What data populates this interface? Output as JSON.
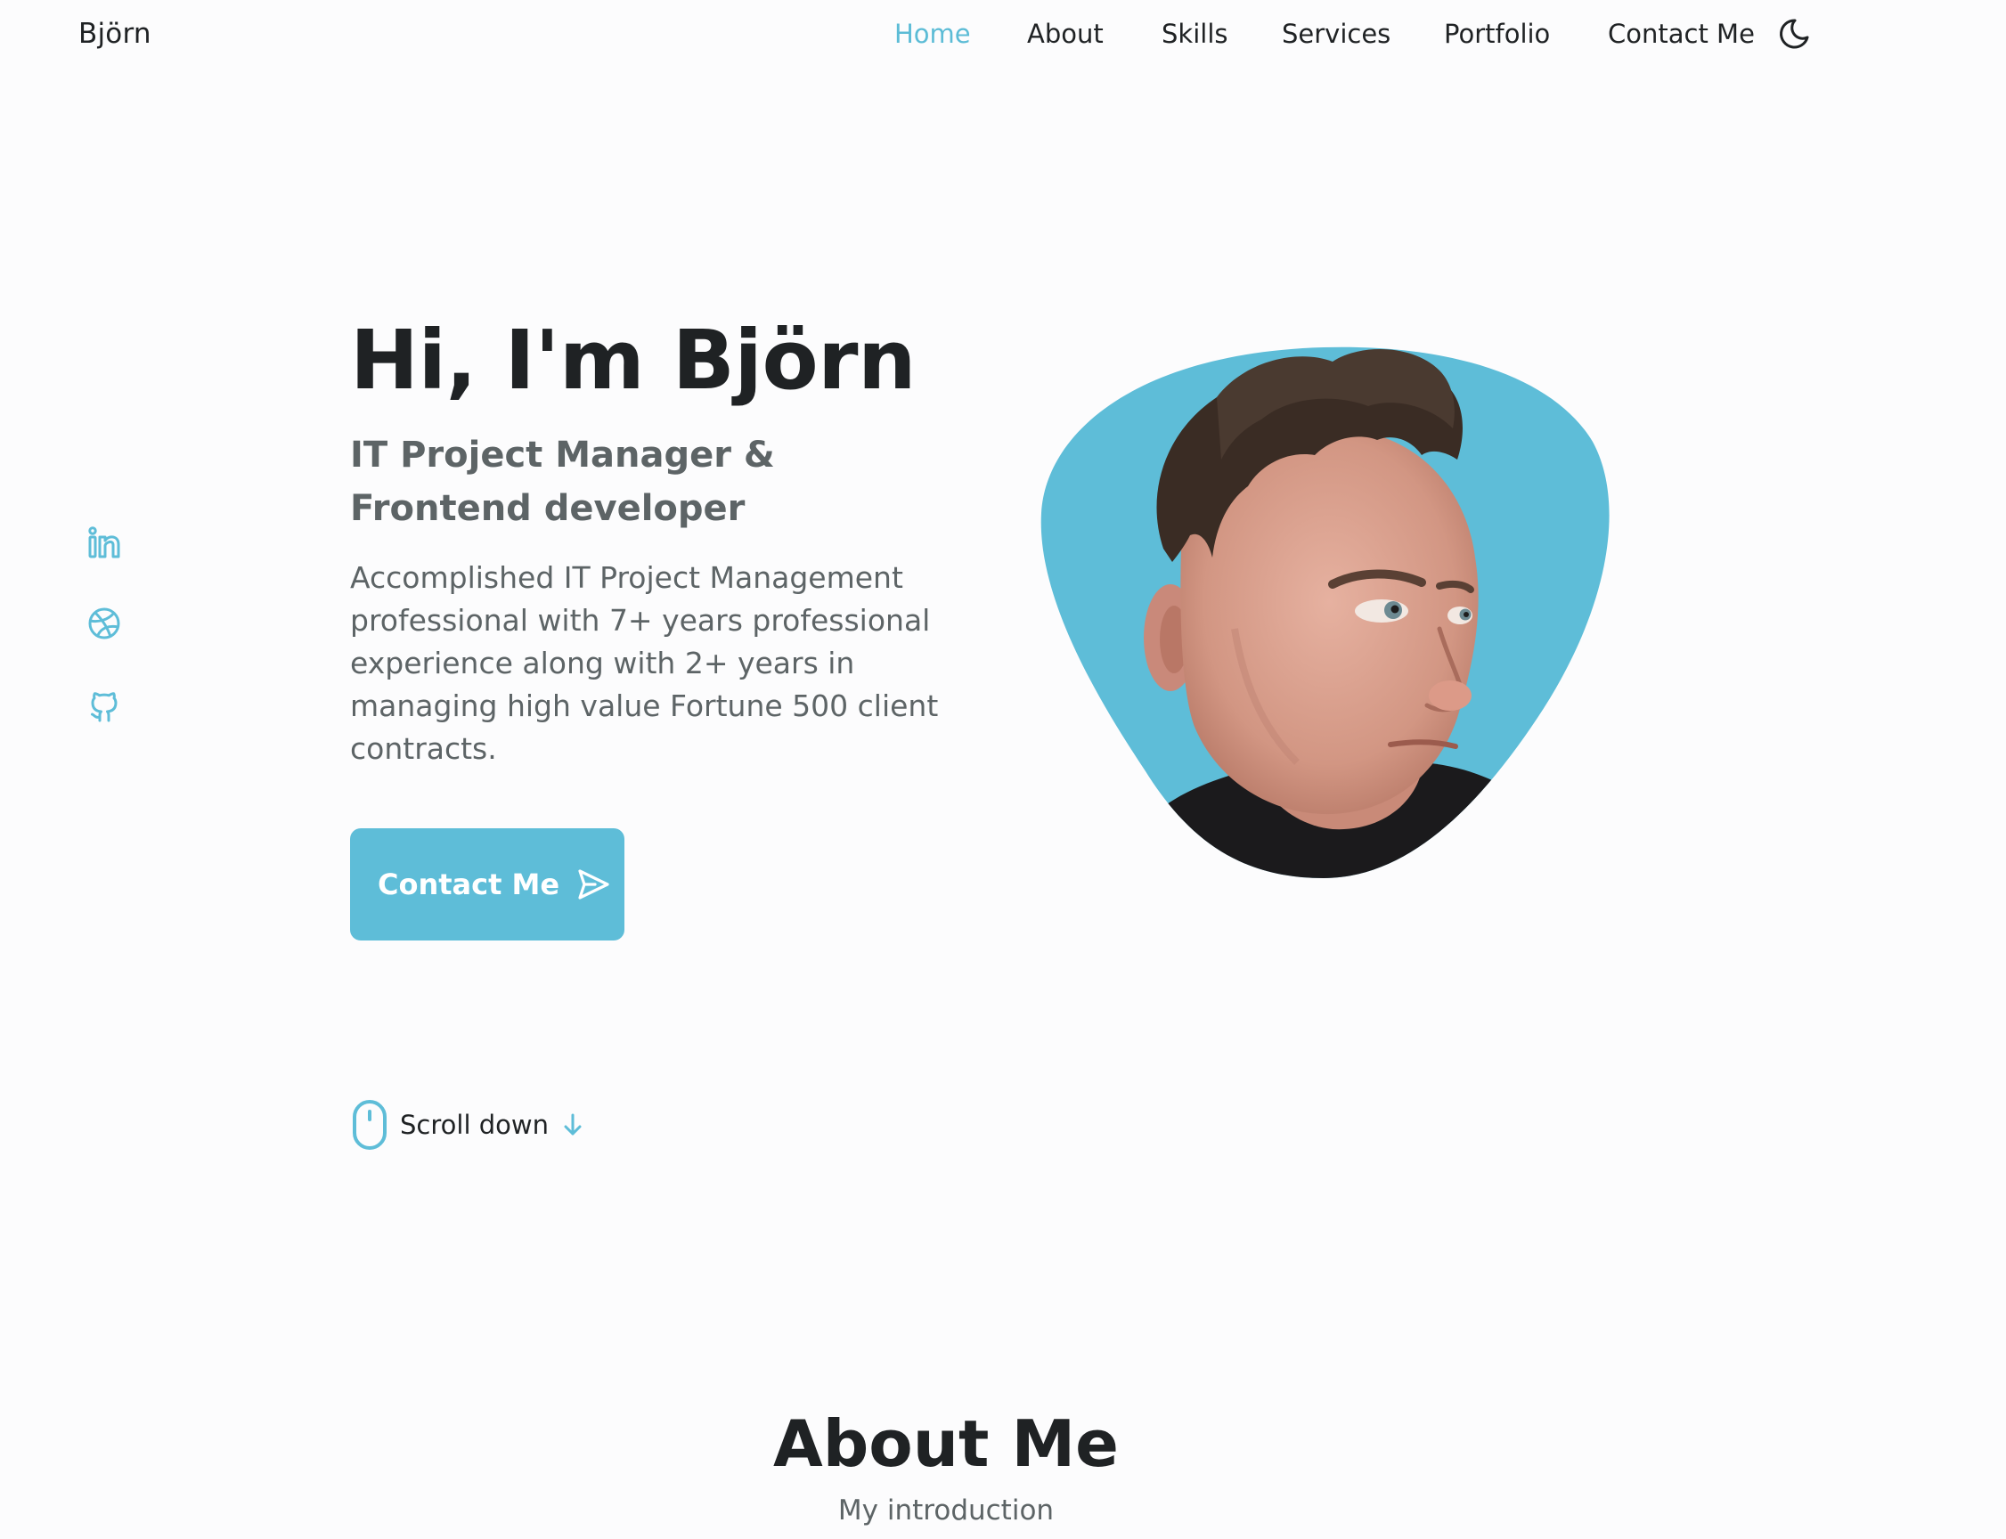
{
  "brand": {
    "name": "Björn"
  },
  "nav": {
    "items": [
      {
        "label": "Home",
        "active": true
      },
      {
        "label": "About",
        "active": false
      },
      {
        "label": "Skills",
        "active": false
      },
      {
        "label": "Services",
        "active": false
      },
      {
        "label": "Portfolio",
        "active": false
      },
      {
        "label": "Contact Me",
        "active": false
      }
    ],
    "theme_toggle_icon": "moon-icon"
  },
  "social": [
    {
      "icon": "linkedin-icon"
    },
    {
      "icon": "dribbble-icon"
    },
    {
      "icon": "github-icon"
    }
  ],
  "hero": {
    "title": "Hi, I'm Björn",
    "subtitle": "IT Project Manager & Frontend developer",
    "description": "Accomplished IT Project Management professional with 7+ years professional experience along with 2+ years in managing high value Fortune 500 client contracts.",
    "contact_button": {
      "label": "Contact Me",
      "icon": "send-icon"
    },
    "image": {
      "subject": "portrait photo",
      "shape": "blob"
    }
  },
  "scroll": {
    "label": "Scroll down",
    "icons": [
      "mouse-icon",
      "arrow-down-icon"
    ]
  },
  "about": {
    "title": "About Me",
    "subtitle": "My introduction"
  },
  "colors": {
    "accent": "#5ebdd8",
    "text": "#1f2224",
    "muted": "#5d6466",
    "background": "#fcfcfd"
  }
}
